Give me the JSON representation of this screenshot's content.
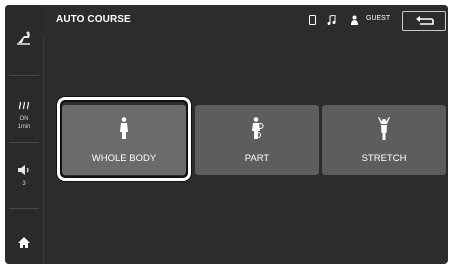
{
  "header": {
    "title": "AUTO COURSE",
    "user_label": "GUEST",
    "icons": [
      "phone-icon",
      "music-icon",
      "user-icon"
    ],
    "back_icon": "return-arrow-icon"
  },
  "sidebar": {
    "heat": {
      "icon": "heat-waves-icon",
      "state": "ON",
      "timer": "1min"
    },
    "volume": {
      "icon": "speaker-icon",
      "level": "3"
    },
    "home_icon": "home-icon",
    "top_icon": "massage-chair-icon"
  },
  "courses": [
    {
      "label": "WHOLE BODY",
      "icon": "whole-body-figure-icon",
      "selected": true
    },
    {
      "label": "PART",
      "icon": "part-body-figure-icon",
      "selected": false
    },
    {
      "label": "STRETCH",
      "icon": "stretch-figure-icon",
      "selected": false
    }
  ],
  "colors": {
    "background": "#2c2c2c",
    "tile": "#5d5d5d",
    "selection_ring": "#ffffff"
  }
}
